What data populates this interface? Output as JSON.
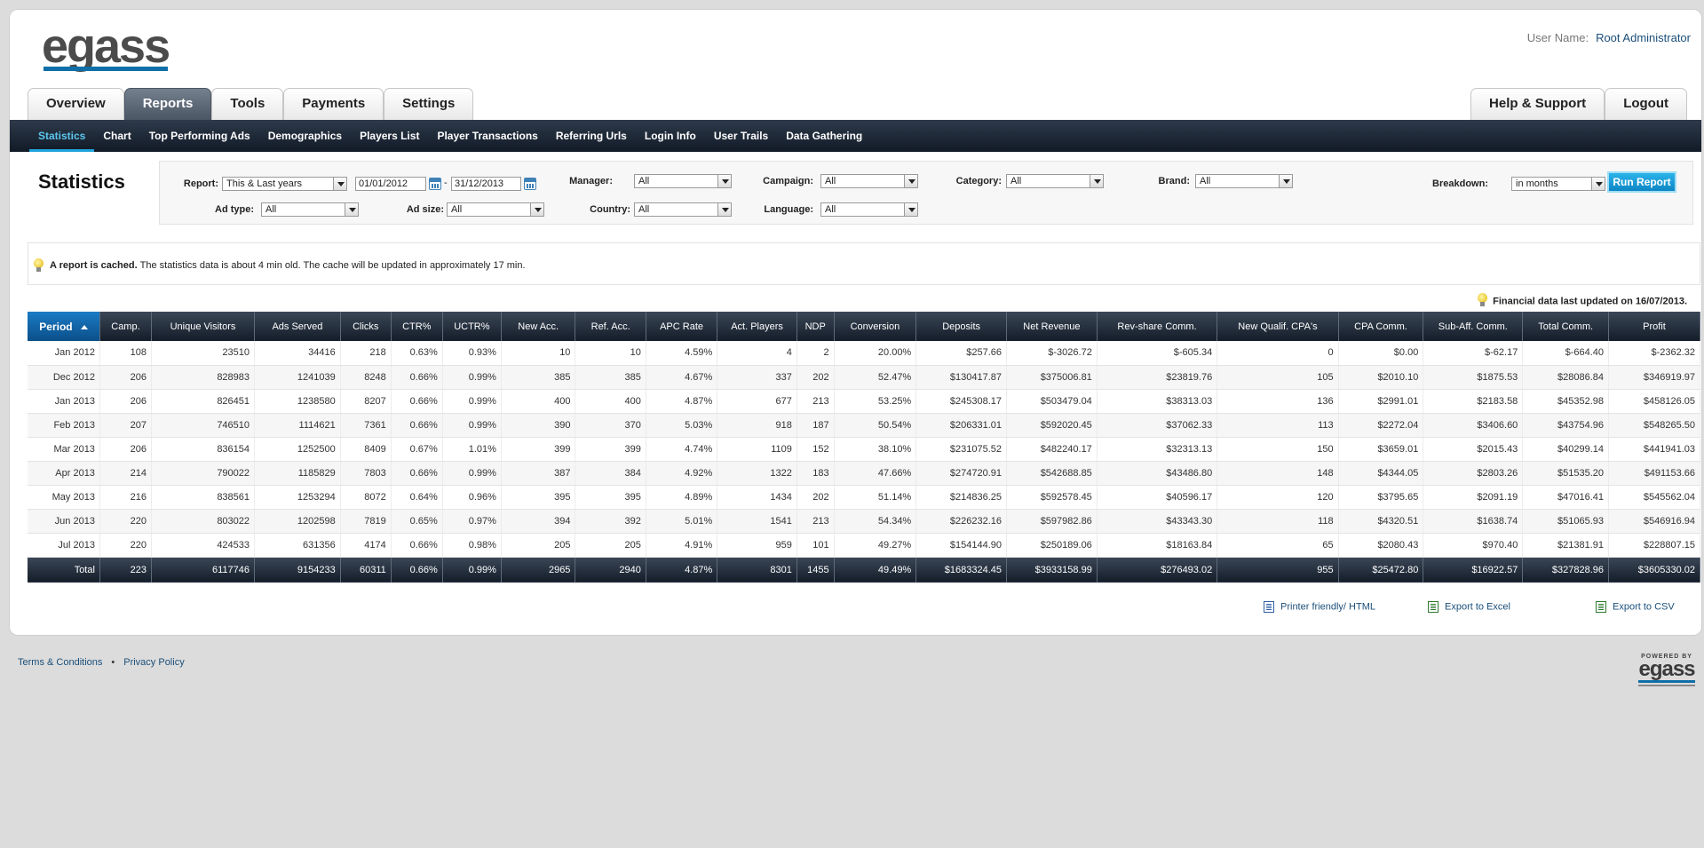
{
  "brand": {
    "logo_text": "egass",
    "powered_by": "POWERED BY",
    "powered_logo": "egass"
  },
  "user": {
    "label": "User Name:",
    "name": "Root Administrator"
  },
  "main_tabs": [
    "Overview",
    "Reports",
    "Tools",
    "Payments",
    "Settings"
  ],
  "right_tabs": [
    "Help & Support",
    "Logout"
  ],
  "subnav": [
    "Statistics",
    "Chart",
    "Top Performing Ads",
    "Demographics",
    "Players List",
    "Player Transactions",
    "Referring Urls",
    "Login Info",
    "User Trails",
    "Data Gathering"
  ],
  "page_title": "Statistics",
  "filters": {
    "report": {
      "label": "Report:",
      "value": "This & Last years"
    },
    "date_from": "01/01/2012",
    "date_sep": "-",
    "date_to": "31/12/2013",
    "manager": {
      "label": "Manager:",
      "value": "All"
    },
    "campaign": {
      "label": "Campaign:",
      "value": "All"
    },
    "category": {
      "label": "Category:",
      "value": "All"
    },
    "brand": {
      "label": "Brand:",
      "value": "All"
    },
    "breakdown": {
      "label": "Breakdown:",
      "value": "in months"
    },
    "ad_type": {
      "label": "Ad type:",
      "value": "All"
    },
    "ad_size": {
      "label": "Ad size:",
      "value": "All"
    },
    "country": {
      "label": "Country:",
      "value": "All"
    },
    "language": {
      "label": "Language:",
      "value": "All"
    },
    "run_label": "Run Report"
  },
  "cache": {
    "bold": "A report is cached.",
    "text": "The statistics data is about 4 min old. The cache will be updated in approximately 17 min."
  },
  "financial_note": "Financial data last updated on 16/07/2013.",
  "table": {
    "headers": [
      "Period",
      "Camp.",
      "Unique Visitors",
      "Ads Served",
      "Clicks",
      "CTR%",
      "UCTR%",
      "New Acc.",
      "Ref. Acc.",
      "APC Rate",
      "Act. Players",
      "NDP",
      "Conversion",
      "Deposits",
      "Net Revenue",
      "Rev-share Comm.",
      "New Qualif. CPA's",
      "CPA Comm.",
      "Sub-Aff. Comm.",
      "Total Comm.",
      "Profit"
    ],
    "rows": [
      [
        "Jan 2012",
        "108",
        "23510",
        "34416",
        "218",
        "0.63%",
        "0.93%",
        "10",
        "10",
        "4.59%",
        "4",
        "2",
        "20.00%",
        "$257.66",
        "$-3026.72",
        "$-605.34",
        "0",
        "$0.00",
        "$-62.17",
        "$-664.40",
        "$-2362.32"
      ],
      [
        "Dec 2012",
        "206",
        "828983",
        "1241039",
        "8248",
        "0.66%",
        "0.99%",
        "385",
        "385",
        "4.67%",
        "337",
        "202",
        "52.47%",
        "$130417.87",
        "$375006.81",
        "$23819.76",
        "105",
        "$2010.10",
        "$1875.53",
        "$28086.84",
        "$346919.97"
      ],
      [
        "Jan 2013",
        "206",
        "826451",
        "1238580",
        "8207",
        "0.66%",
        "0.99%",
        "400",
        "400",
        "4.87%",
        "677",
        "213",
        "53.25%",
        "$245308.17",
        "$503479.04",
        "$38313.03",
        "136",
        "$2991.01",
        "$2183.58",
        "$45352.98",
        "$458126.05"
      ],
      [
        "Feb 2013",
        "207",
        "746510",
        "1114621",
        "7361",
        "0.66%",
        "0.99%",
        "390",
        "370",
        "5.03%",
        "918",
        "187",
        "50.54%",
        "$206331.01",
        "$592020.45",
        "$37062.33",
        "113",
        "$2272.04",
        "$3406.60",
        "$43754.96",
        "$548265.50"
      ],
      [
        "Mar 2013",
        "206",
        "836154",
        "1252500",
        "8409",
        "0.67%",
        "1.01%",
        "399",
        "399",
        "4.74%",
        "1109",
        "152",
        "38.10%",
        "$231075.52",
        "$482240.17",
        "$32313.13",
        "150",
        "$3659.01",
        "$2015.43",
        "$40299.14",
        "$441941.03"
      ],
      [
        "Apr 2013",
        "214",
        "790022",
        "1185829",
        "7803",
        "0.66%",
        "0.99%",
        "387",
        "384",
        "4.92%",
        "1322",
        "183",
        "47.66%",
        "$274720.91",
        "$542688.85",
        "$43486.80",
        "148",
        "$4344.05",
        "$2803.26",
        "$51535.20",
        "$491153.66"
      ],
      [
        "May 2013",
        "216",
        "838561",
        "1253294",
        "8072",
        "0.64%",
        "0.96%",
        "395",
        "395",
        "4.89%",
        "1434",
        "202",
        "51.14%",
        "$214836.25",
        "$592578.45",
        "$40596.17",
        "120",
        "$3795.65",
        "$2091.19",
        "$47016.41",
        "$545562.04"
      ],
      [
        "Jun 2013",
        "220",
        "803022",
        "1202598",
        "7819",
        "0.65%",
        "0.97%",
        "394",
        "392",
        "5.01%",
        "1541",
        "213",
        "54.34%",
        "$226232.16",
        "$597982.86",
        "$43343.30",
        "118",
        "$4320.51",
        "$1638.74",
        "$51065.93",
        "$546916.94"
      ],
      [
        "Jul 2013",
        "220",
        "424533",
        "631356",
        "4174",
        "0.66%",
        "0.98%",
        "205",
        "205",
        "4.91%",
        "959",
        "101",
        "49.27%",
        "$154144.90",
        "$250189.06",
        "$18163.84",
        "65",
        "$2080.43",
        "$970.40",
        "$21381.91",
        "$228807.15"
      ]
    ],
    "total": [
      "Total",
      "223",
      "6117746",
      "9154233",
      "60311",
      "0.66%",
      "0.99%",
      "2965",
      "2940",
      "4.87%",
      "8301",
      "1455",
      "49.49%",
      "$1683324.45",
      "$3933158.99",
      "$276493.02",
      "955",
      "$25472.80",
      "$16922.57",
      "$327828.96",
      "$3605330.02"
    ]
  },
  "exports": {
    "print": "Printer friendly/ HTML",
    "excel": "Export to Excel",
    "csv": "Export to CSV"
  },
  "footer": {
    "terms": "Terms & Conditions",
    "dot": "•",
    "privacy": "Privacy Policy"
  }
}
